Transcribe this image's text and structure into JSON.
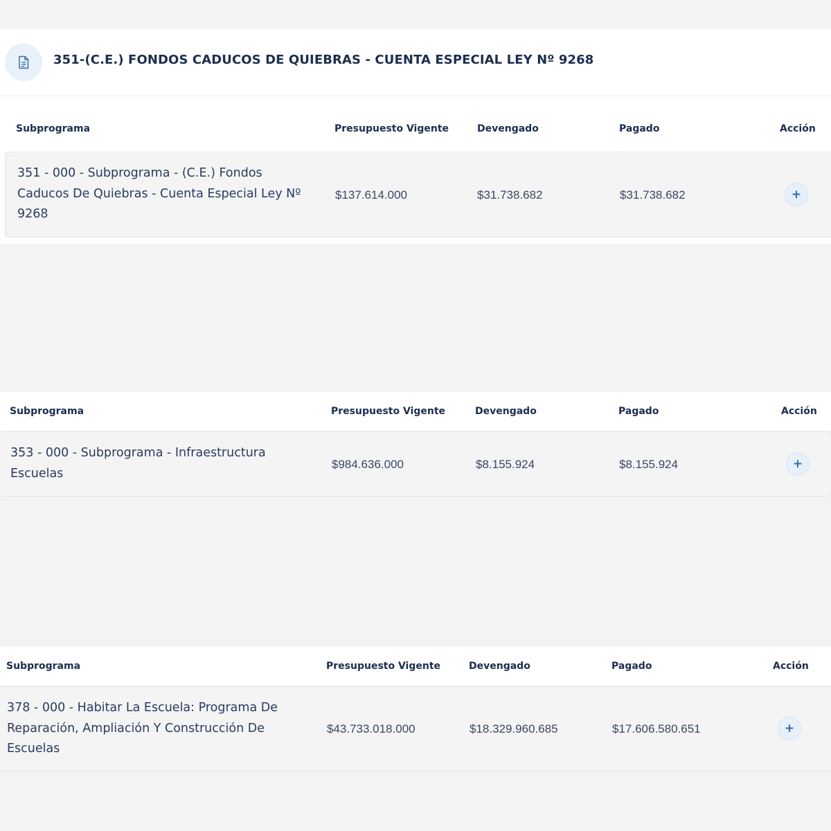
{
  "header": {
    "title": "351-(C.E.) FONDOS CADUCOS DE QUIEBRAS - CUENTA ESPECIAL LEY Nº 9268",
    "icon": "document-icon"
  },
  "columns": {
    "subprograma": "Subprograma",
    "presupuesto": "Presupuesto Vigente",
    "devengado": "Devengado",
    "pagado": "Pagado",
    "accion": "Acción"
  },
  "tables": [
    {
      "rows": [
        {
          "subprograma": "351 - 000 - Subprograma - (C.E.) Fondos Caducos De Quiebras - Cuenta Especial Ley Nº 9268",
          "presupuesto": "$137.614.000",
          "devengado": "$31.738.682",
          "pagado": "$31.738.682",
          "action_icon": "+"
        }
      ]
    },
    {
      "rows": [
        {
          "subprograma": "353 - 000 - Subprograma - Infraestructura Escuelas",
          "presupuesto": "$984.636.000",
          "devengado": "$8.155.924",
          "pagado": "$8.155.924",
          "action_icon": "+"
        }
      ]
    },
    {
      "rows": [
        {
          "subprograma": "378 - 000 - Habitar La Escuela: Programa De Reparación, Ampliación Y Construcción De Escuelas",
          "presupuesto": "$43.733.018.000",
          "devengado": "$18.329.960.685",
          "pagado": "$17.606.580.651",
          "action_icon": "+"
        }
      ]
    }
  ],
  "colors": {
    "accent": "#2e6bb0",
    "text": "#1c2d4f",
    "row_bg": "#f4f4f5",
    "page_bg": "#f3f3f3"
  }
}
